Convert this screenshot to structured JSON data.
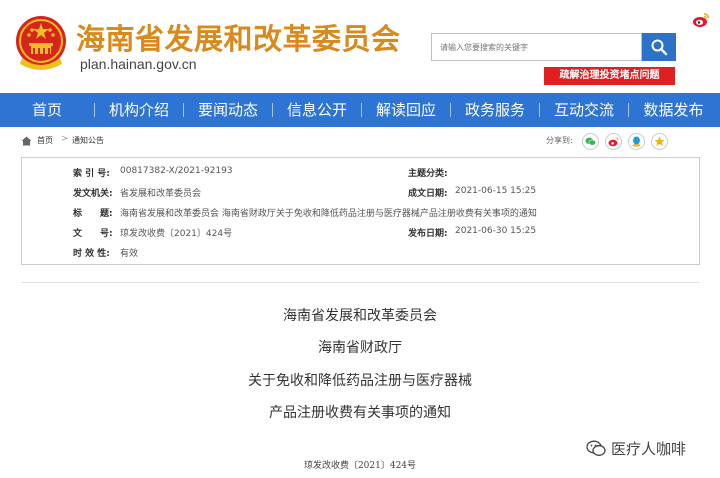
{
  "header": {
    "site_title": "海南省发展和改革委员会",
    "site_url": "plan.hainan.gov.cn",
    "search_placeholder": "请输入您要搜索的关键字",
    "notice_button": "疏解治理投资堵点问题"
  },
  "nav": {
    "items": [
      "首页",
      "机构介绍",
      "要闻动态",
      "信息公开",
      "解读回应",
      "政务服务",
      "互动交流",
      "数据发布"
    ]
  },
  "breadcrumb": {
    "home": "首页",
    "current": "通知公告",
    "share_label": "分享到:"
  },
  "info": {
    "index_label": "索 引 号:",
    "index_value": "00817382-X/2021-92193",
    "topic_label": "主题分类:",
    "topic_value": "",
    "issuer_label": "发文机关:",
    "issuer_value": "省发展和改革委员会",
    "created_label": "成文日期:",
    "created_value": "2021-06-15 15:25",
    "title_label": "标　　题:",
    "title_value": "海南省发展和改革委员会 海南省财政厅关于免收和降低药品注册与医疗器械产品注册收费有关事项的通知",
    "docno_label": "文　　号:",
    "docno_value": "琼发改收费〔2021〕424号",
    "published_label": "发布日期:",
    "published_value": "2021-06-30 15:25",
    "validity_label": "时 效 性:",
    "validity_value": "有效"
  },
  "document": {
    "line1": "海南省发展和改革委员会",
    "line2": "海南省财政厅",
    "line3": "关于免收和降低药品注册与医疗器械",
    "line4": "产品注册收费有关事项的通知",
    "number": "琼发改收费〔2021〕424号"
  },
  "watermark": {
    "text": "医疗人咖啡"
  },
  "colors": {
    "nav_blue": "#2e74d2",
    "title_gold": "#d98a1c",
    "notice_red": "#e02020"
  }
}
